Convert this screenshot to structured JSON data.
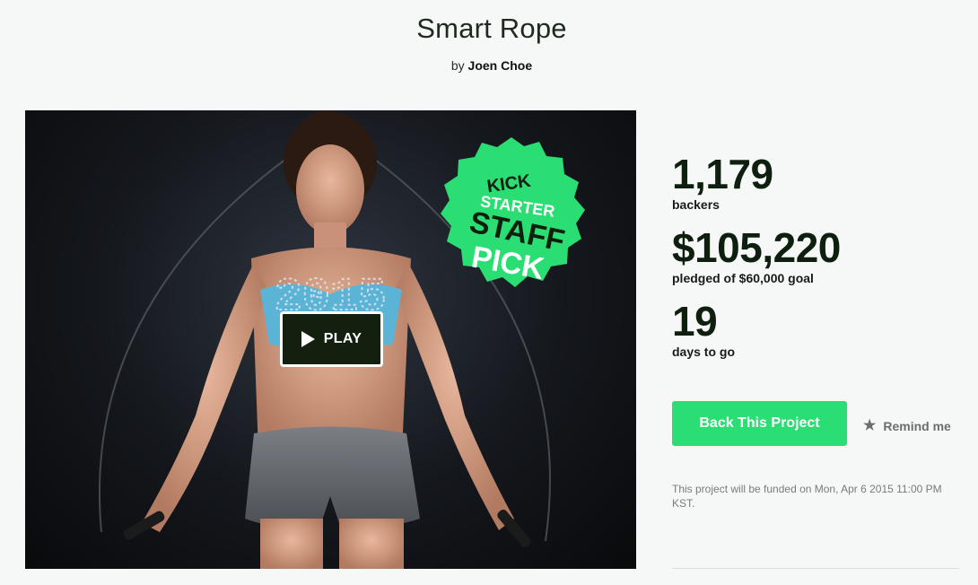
{
  "project": {
    "title": "Smart Rope",
    "by_prefix": "by",
    "author": "Joen Choe"
  },
  "video": {
    "play_label": "PLAY",
    "badge_lines": [
      "KICK",
      "STARTER",
      "STAFF",
      "PICK"
    ],
    "display_text": "2015"
  },
  "stats": {
    "backers_value": "1,179",
    "backers_label": "backers",
    "pledged_value": "$105,220",
    "pledged_label": "pledged of $60,000 goal",
    "days_value": "19",
    "days_label": "days to go"
  },
  "actions": {
    "back_label": "Back This Project",
    "remind_label": "Remind me"
  },
  "funding_note": "This project will be funded on Mon, Apr 6 2015 11:00 PM KST.",
  "colors": {
    "accent_green": "#2bde73",
    "play_bg": "#13200f",
    "page_bg": "#f6f8f8"
  }
}
